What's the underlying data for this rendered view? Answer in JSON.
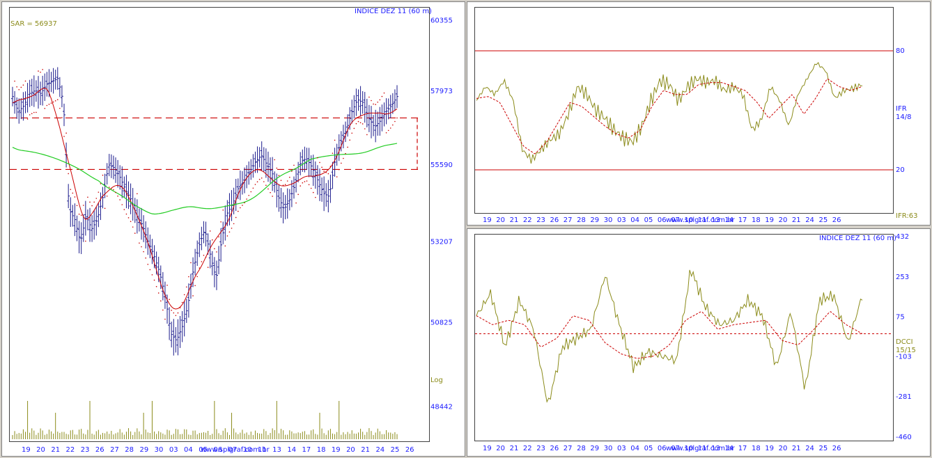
{
  "colors": {
    "bars": "#1a1a8c",
    "red": "#cc0000",
    "green": "#22cc22",
    "olive": "#8b8b1a",
    "axis_text": "#1a1aff"
  },
  "main": {
    "title": "INDICE DEZ 11 (60 m)",
    "sar_label": "SAR = 56937",
    "yscale_label": "Log",
    "watermark": "www.splgraf.com.br"
  },
  "ifr": {
    "label1": "IFR",
    "label2": "14/8",
    "value_label": "IFR:63"
  },
  "dcci": {
    "title": "INDICE DEZ 11 (60 m)",
    "label1": "DCCI",
    "label2": "15/15"
  },
  "chart_data": [
    {
      "type": "candlestick",
      "title": "INDICE DEZ 11 (60 m)",
      "ylim": [
        47500,
        60800
      ],
      "yscale": "log",
      "yticks": [
        "60355",
        "57973",
        "55590",
        "53207",
        "50825",
        "48442"
      ],
      "x_labels": [
        "19",
        "20",
        "21",
        "22",
        "23",
        "26",
        "27",
        "28",
        "29",
        "30",
        "03",
        "04",
        "05",
        "06",
        "07",
        "10",
        "11",
        "13",
        "14",
        "17",
        "18",
        "19",
        "20",
        "21",
        "24",
        "25",
        "26"
      ],
      "close": [
        57800,
        57300,
        57500,
        57900,
        58000,
        57900,
        58200,
        58300,
        58400,
        57600,
        54200,
        53900,
        53200,
        54000,
        53600,
        53900,
        54600,
        55600,
        55500,
        55200,
        54800,
        54500,
        54000,
        53700,
        53200,
        52800,
        52300,
        51600,
        50500,
        50300,
        50700,
        51300,
        52400,
        53100,
        53600,
        52800,
        52100,
        53300,
        54100,
        54400,
        54900,
        55100,
        55400,
        55700,
        55900,
        55600,
        55300,
        54600,
        54200,
        54500,
        55000,
        55700,
        55800,
        55500,
        55100,
        54700,
        54600,
        55700,
        56300,
        56700,
        57300,
        57700,
        57600,
        57100,
        56800,
        57000,
        57300,
        57500,
        57800
      ],
      "volume_note": "volume histogram below price",
      "lines": [
        "SAR (red dotted)",
        "moving average (red)",
        "long moving average (green)"
      ],
      "horizontal_levels": [
        57100,
        55450
      ]
    },
    {
      "type": "line",
      "name": "IFR 14/8",
      "ylim": [
        0,
        100
      ],
      "yticks": [
        "80",
        "20"
      ],
      "x_labels": [
        "19",
        "20",
        "21",
        "22",
        "23",
        "26",
        "27",
        "28",
        "29",
        "30",
        "03",
        "04",
        "05",
        "06",
        "07",
        "10",
        "11",
        "13",
        "14",
        "17",
        "18",
        "19",
        "20",
        "21",
        "24",
        "25",
        "26"
      ],
      "values": [
        55,
        62,
        58,
        65,
        55,
        30,
        25,
        30,
        35,
        38,
        48,
        62,
        58,
        50,
        46,
        40,
        36,
        34,
        42,
        55,
        65,
        63,
        55,
        62,
        66,
        64,
        65,
        60,
        62,
        58,
        40,
        45,
        62,
        55,
        42,
        58,
        66,
        74,
        70,
        56,
        60,
        61,
        63
      ],
      "signal": [
        56,
        57,
        54,
        43,
        32,
        28,
        34,
        44,
        54,
        52,
        47,
        42,
        38,
        36,
        40,
        52,
        60,
        58,
        58,
        63,
        64,
        64,
        62,
        60,
        54,
        46,
        52,
        58,
        48,
        56,
        66,
        62,
        60,
        62
      ],
      "levels": [
        80,
        20
      ]
    },
    {
      "type": "line",
      "name": "DCCI 15/15",
      "title": "INDICE DEZ 11 (60 m)",
      "ylim": [
        -460,
        432
      ],
      "yticks": [
        "432",
        "253",
        "75",
        "-103",
        "-281",
        "-460"
      ],
      "x_labels": [
        "19",
        "20",
        "21",
        "22",
        "23",
        "26",
        "27",
        "28",
        "29",
        "30",
        "03",
        "04",
        "05",
        "06",
        "07",
        "10",
        "11",
        "13",
        "14",
        "17",
        "18",
        "19",
        "20",
        "21",
        "24",
        "25",
        "26"
      ],
      "values": [
        80,
        180,
        -60,
        150,
        20,
        -320,
        -60,
        -20,
        20,
        260,
        40,
        -150,
        -80,
        -100,
        -120,
        290,
        120,
        40,
        60,
        150,
        80,
        -150,
        100,
        -250,
        150,
        170,
        -40,
        170
      ],
      "signal": [
        80,
        40,
        60,
        40,
        -60,
        -20,
        80,
        60,
        -40,
        -90,
        -110,
        -100,
        -50,
        60,
        100,
        20,
        40,
        50,
        60,
        -30,
        -50,
        20,
        100,
        40,
        0
      ],
      "zero_line": 0
    }
  ]
}
